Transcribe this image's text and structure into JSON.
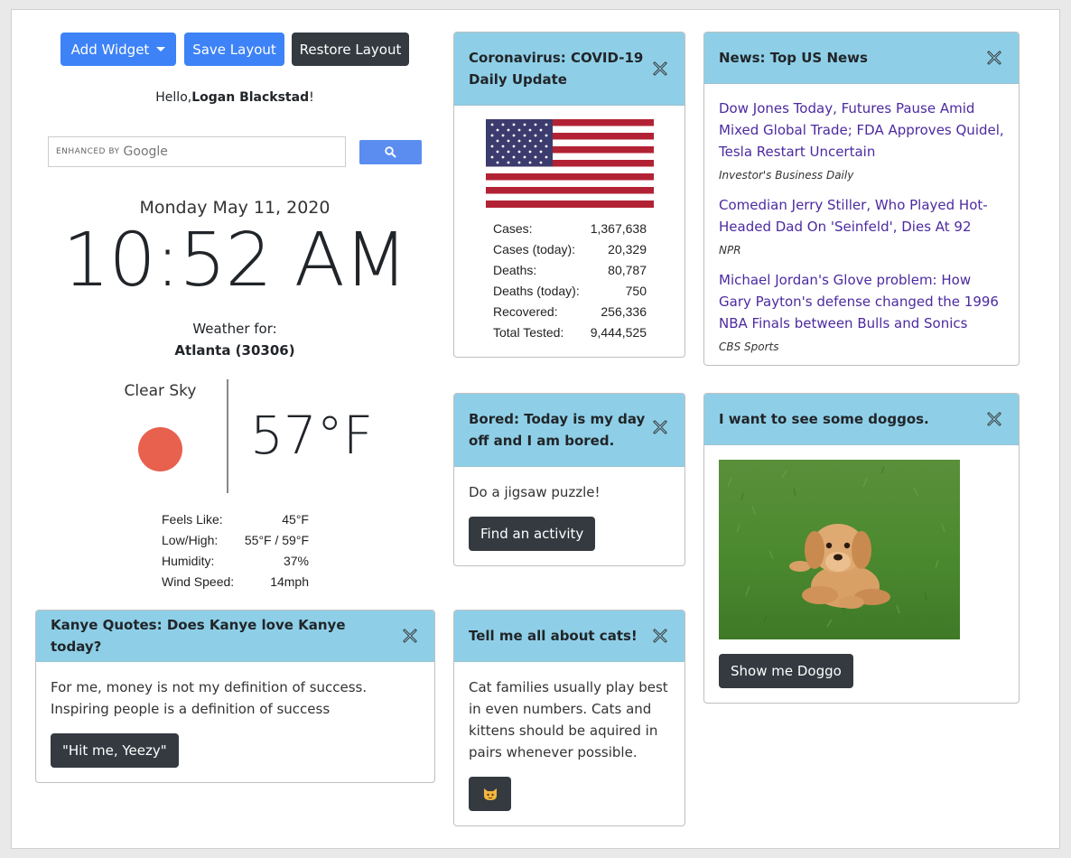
{
  "toolbar": {
    "add_widget_label": "Add Widget",
    "save_layout_label": "Save Layout",
    "restore_layout_label": "Restore Layout"
  },
  "greeting": {
    "prefix": "Hello,",
    "name": "Logan Blackstad",
    "suffix": "!"
  },
  "search": {
    "enhanced_by": "ENHANCED BY",
    "brand": "Google",
    "value": "",
    "icon": "search-icon"
  },
  "clock": {
    "date": "Monday May 11, 2020",
    "time": "10:52 AM"
  },
  "weather": {
    "label": "Weather for:",
    "location": "Atlanta (30306)",
    "condition": "Clear Sky",
    "temperature": "57°F",
    "icon_color": "#e8604e",
    "details": [
      {
        "label": "Feels Like:",
        "value": "45°F"
      },
      {
        "label": "Low/High:",
        "value": "55°F / 59°F"
      },
      {
        "label": "Humidity:",
        "value": "37%"
      },
      {
        "label": "Wind Speed:",
        "value": "14mph"
      }
    ]
  },
  "covid": {
    "title": "Coronavirus: COVID-19 Daily Update",
    "flag": "us-flag",
    "stats": [
      {
        "label": "Cases:",
        "value": "1,367,638"
      },
      {
        "label": "Cases (today):",
        "value": "20,329"
      },
      {
        "label": "Deaths:",
        "value": "80,787"
      },
      {
        "label": "Deaths (today):",
        "value": "750"
      },
      {
        "label": "Recovered:",
        "value": "256,336"
      },
      {
        "label": "Total Tested:",
        "value": "9,444,525"
      }
    ]
  },
  "news": {
    "title": "News: Top US News",
    "items": [
      {
        "headline": "Dow Jones Today, Futures Pause Amid Mixed Global Trade; FDA Approves Quidel, Tesla Restart Uncertain",
        "source": "Investor's Business Daily"
      },
      {
        "headline": "Comedian Jerry Stiller, Who Played Hot-Headed Dad On 'Seinfeld', Dies At 92",
        "source": "NPR"
      },
      {
        "headline": "Michael Jordan's Glove problem: How Gary Payton's defense changed the 1996 NBA Finals between Bulls and Sonics",
        "source": "CBS Sports"
      }
    ]
  },
  "bored": {
    "title": "Bored: Today is my day off and I am bored.",
    "activity": "Do a jigsaw puzzle!",
    "button_label": "Find an activity"
  },
  "doggos": {
    "title": "I want to see some doggos.",
    "image": "puppy-photo",
    "button_label": "Show me Doggo"
  },
  "kanye": {
    "title": "Kanye Quotes: Does Kanye love Kanye today?",
    "quote": "For me, money is not my definition of success. Inspiring people is a definition of success",
    "button_label": "\"Hit me, Yeezy\""
  },
  "cats": {
    "title": "Tell me all about cats!",
    "fact": "Cat families usually play best in even numbers. Cats and kittens should be aquired in pairs whenever possible.",
    "button_icon": "cat-face-icon"
  },
  "colors": {
    "primary": "#3d82f6",
    "dark": "#343a40",
    "card_header": "#8ecfe7",
    "link": "#4c2aa0"
  }
}
